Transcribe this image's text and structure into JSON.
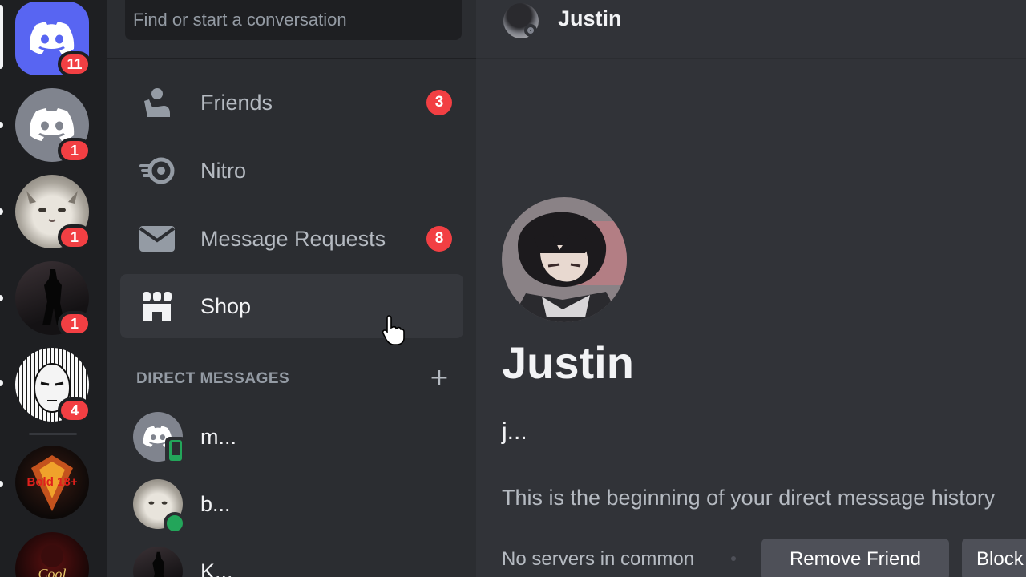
{
  "rail": {
    "servers": [
      {
        "name": "Home",
        "badge": "11"
      },
      {
        "name": "Discord",
        "badge": "1"
      },
      {
        "name": "Cat",
        "badge": "1"
      },
      {
        "name": "Dark figure",
        "badge": "1"
      },
      {
        "name": "Manga",
        "badge": "4"
      },
      {
        "name": "Bold 18+",
        "logo_text": "Bold 18+"
      },
      {
        "name": "Cool",
        "logo_text": "Cool"
      }
    ]
  },
  "search": {
    "placeholder": "Find or start a conversation"
  },
  "nav": [
    {
      "label": "Friends",
      "icon": "friends-icon",
      "badge": "3"
    },
    {
      "label": "Nitro",
      "icon": "nitro-icon"
    },
    {
      "label": "Message Requests",
      "icon": "envelope-icon",
      "badge": "8"
    },
    {
      "label": "Shop",
      "icon": "shop-icon"
    }
  ],
  "direct_messages": {
    "header": "DIRECT MESSAGES",
    "add_icon": "+",
    "items": [
      {
        "name": "m...",
        "status": "mobile"
      },
      {
        "name": "b...",
        "status": "online"
      },
      {
        "name": "K..."
      }
    ]
  },
  "channel": {
    "title": "Justin",
    "profile_name": "Justin",
    "username": "j...",
    "history_text": "This is the beginning of your direct message history",
    "mutual": "No servers in common",
    "remove_friend_label": "Remove Friend",
    "block_label": "Block"
  },
  "colors": {
    "blurple": "#5865f2",
    "badge_red": "#f23f43",
    "online_green": "#23a55a",
    "sidebar_bg": "#2b2d31",
    "rail_bg": "#1e1f22",
    "main_bg": "#313338"
  }
}
